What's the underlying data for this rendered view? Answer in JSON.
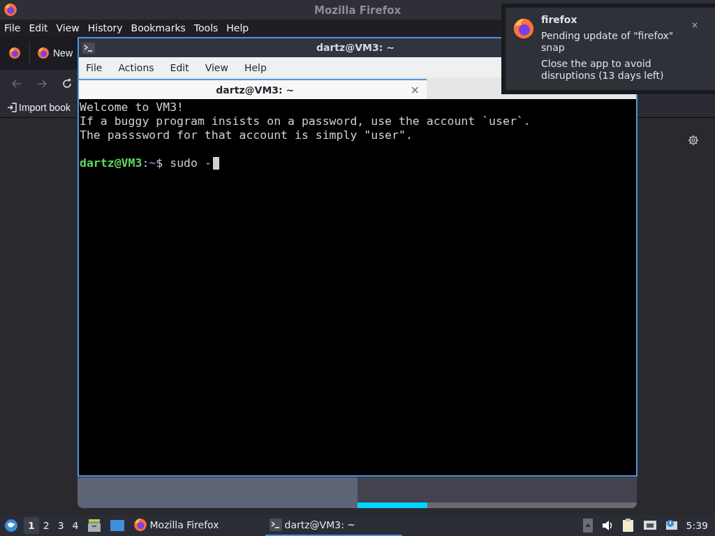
{
  "firefox": {
    "title": "Mozilla Firefox",
    "menu": [
      {
        "label": "File"
      },
      {
        "label": "Edit"
      },
      {
        "label": "View"
      },
      {
        "label": "History"
      },
      {
        "label": "Bookmarks"
      },
      {
        "label": "Tools"
      },
      {
        "label": "Help"
      }
    ],
    "tabs": [
      {
        "label": "New"
      }
    ],
    "bookmarks": [
      {
        "label": "Import book"
      }
    ]
  },
  "terminal": {
    "title": "dartz@VM3: ~",
    "menu": [
      {
        "label": "File"
      },
      {
        "label": "Actions"
      },
      {
        "label": "Edit"
      },
      {
        "label": "View"
      },
      {
        "label": "Help"
      }
    ],
    "tab": {
      "title": "dartz@VM3: ~",
      "close": "×"
    },
    "lines": [
      "Welcome to VM3!",
      "If a buggy program insists on a password, use the account `user`.",
      "The passsword for that account is simply \"user\"."
    ],
    "prompt": {
      "user_host": "dartz@VM3",
      "separator": ":",
      "path": "~",
      "symbol": "$",
      "command": "sudo -",
      "cursor": true
    }
  },
  "preview_bar": {
    "level": 0.25
  },
  "notification": {
    "app": "firefox",
    "close": "×",
    "messages": [
      "Pending update of \"firefox\" snap",
      "Close the app to avoid disruptions (13 days left)"
    ]
  },
  "taskbar": {
    "workspaces": [
      {
        "label": "1",
        "selected": true
      },
      {
        "label": "2",
        "selected": false
      },
      {
        "label": "3",
        "selected": false
      },
      {
        "label": "4",
        "selected": false
      }
    ],
    "tasks": [
      {
        "kind": "firefox",
        "label": "Mozilla Firefox",
        "selected": false
      },
      {
        "kind": "terminal",
        "label": "dartz@VM3: ~",
        "selected": true
      }
    ],
    "clock": "5:39"
  }
}
